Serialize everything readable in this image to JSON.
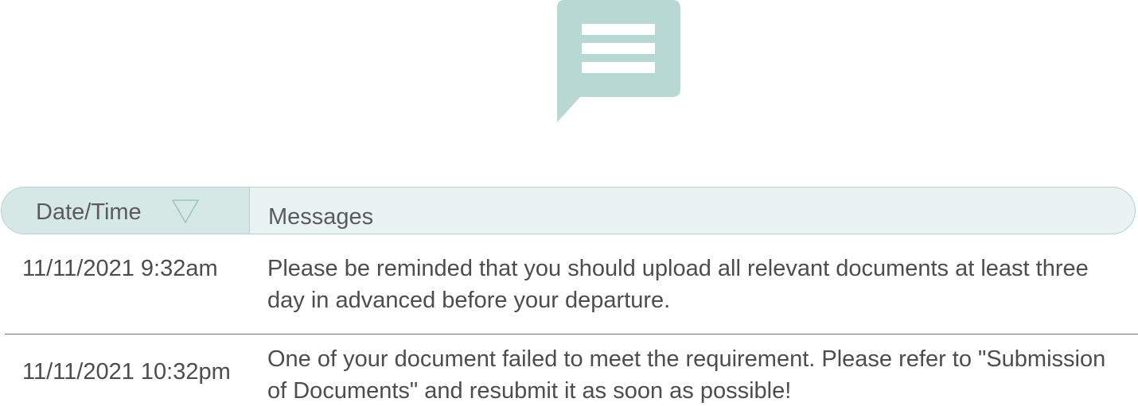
{
  "icons": {
    "header_icon": "message-bubble-icon",
    "sort_icon": "triangle-down-icon"
  },
  "colors": {
    "icon_fill": "#b8d8d4",
    "header_bg": "#e8f3f2",
    "header_date_bg": "#d6e8e6",
    "header_border": "#b3d2cf"
  },
  "table": {
    "headers": {
      "date": "Date/Time",
      "messages": "Messages"
    },
    "rows": [
      {
        "date": "11/11/2021 9:32am",
        "message": "Please be reminded that you should upload all relevant documents at least three day in advanced before your departure."
      },
      {
        "date": "11/11/2021 10:32pm",
        "message": "One of your document failed to meet the requirement. Please refer to \"Submission of Documents\" and resubmit it as soon as possible!"
      }
    ]
  }
}
